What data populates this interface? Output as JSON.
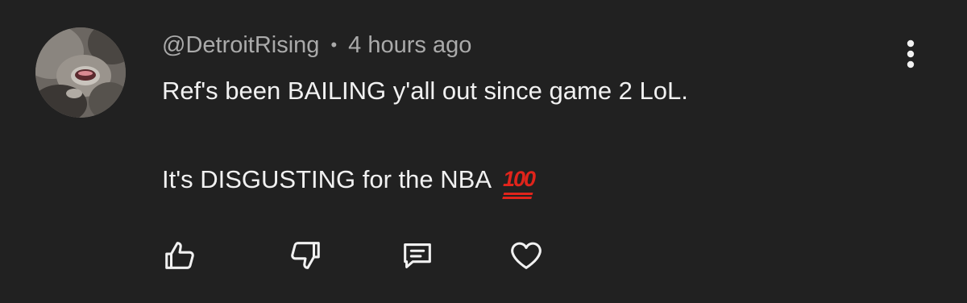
{
  "comment": {
    "author": "@DetroitRising",
    "separator": "•",
    "time": "4 hours ago",
    "lines": [
      "Ref's been BAILING y'all out since game 2 LoL.",
      "It's DISGUSTING for the NBA"
    ],
    "emoji": "100",
    "emoji_name": "hundred-points-emoji",
    "emoji_color": "#e0241b"
  },
  "actions": [
    {
      "name": "like-icon"
    },
    {
      "name": "dislike-icon"
    },
    {
      "name": "reply-icon"
    },
    {
      "name": "heart-icon"
    }
  ],
  "menu": {
    "icon": "more-vertical-icon"
  },
  "colors": {
    "background": "#212121",
    "text": "#f1f1f1",
    "secondary": "#aaaaaa"
  }
}
